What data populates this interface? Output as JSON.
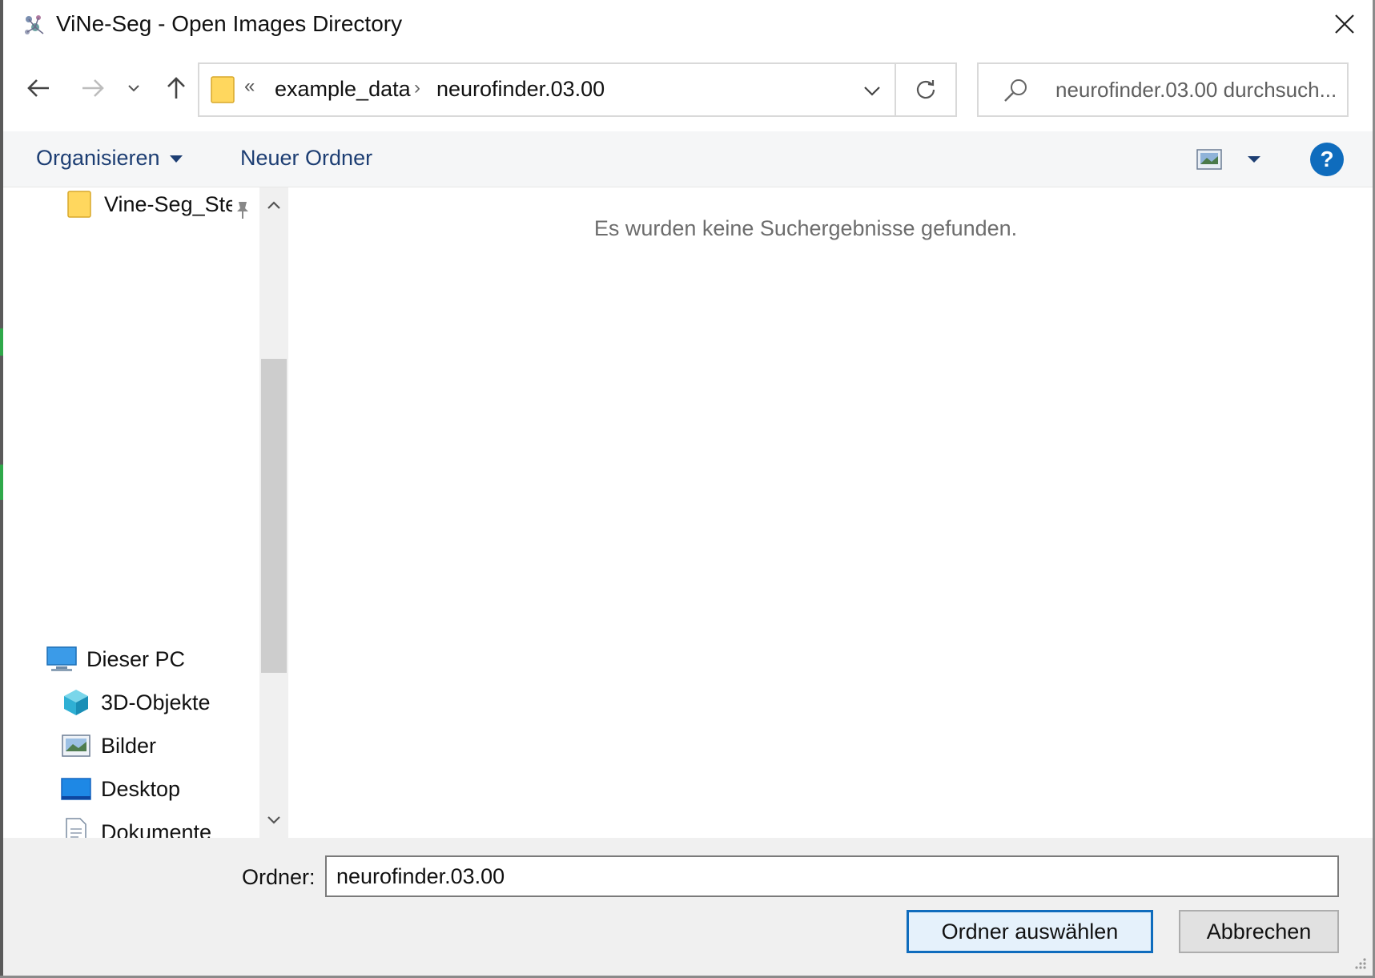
{
  "window": {
    "title": "ViNe-Seg - Open Images Directory",
    "app_icon": "vineseg-app-icon",
    "close_icon": "close-icon"
  },
  "nav": {
    "back_icon": "arrow-left-icon",
    "forward_icon": "arrow-right-icon",
    "recent_icon": "chevron-down-icon",
    "up_icon": "arrow-up-icon",
    "breadcrumb_prefix": "«",
    "breadcrumbs": [
      "example_data",
      "neurofinder.03.00"
    ],
    "breadcrumb_separator": "›",
    "refresh_icon": "refresh-icon",
    "search_placeholder": "neurofinder.03.00 durchsuch..."
  },
  "commandbar": {
    "organize_label": "Organisieren",
    "new_folder_label": "Neuer Ordner",
    "view_icon": "view-mode-icon",
    "help_label": "?"
  },
  "sidebar": {
    "pinned_item": {
      "label": "Vine-Seg_Ste|",
      "icon": "folder-icon",
      "pin_icon": "pin-icon"
    },
    "this_pc": {
      "label": "Dieser PC",
      "icon": "computer-icon"
    },
    "items": [
      {
        "label": "3D-Objekte",
        "icon": "3d-objects-icon"
      },
      {
        "label": "Bilder",
        "icon": "pictures-icon"
      },
      {
        "label": "Desktop",
        "icon": "desktop-icon"
      },
      {
        "label": "Dokumente",
        "icon": "documents-icon"
      }
    ]
  },
  "content": {
    "empty_message": "Es wurden keine Suchergebnisse gefunden."
  },
  "footer": {
    "folder_label": "Ordner:",
    "folder_value": "neurofinder.03.00",
    "select_button": "Ordner auswählen",
    "cancel_button": "Abbrechen"
  },
  "colors": {
    "accent": "#0f6cbd",
    "command_text": "#1d3e73",
    "folder_yellow": "#ffd75e"
  }
}
